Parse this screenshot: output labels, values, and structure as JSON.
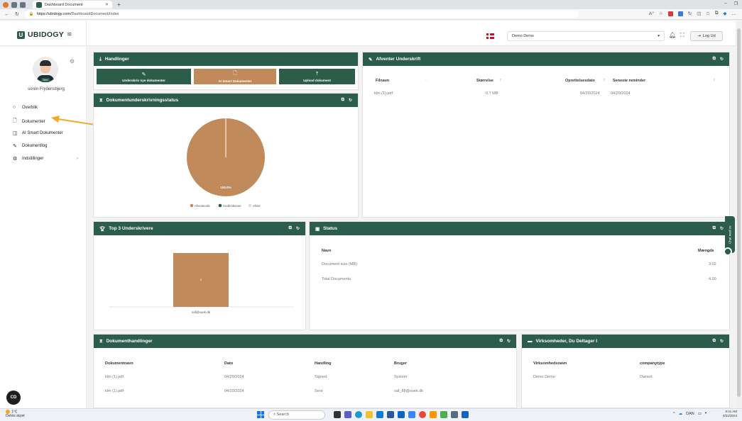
{
  "browser": {
    "tab_title": "Dashboard Document",
    "url_host": "https://ubidogy.com",
    "url_path": "/DashboardDocument/Index"
  },
  "header": {
    "brand": "UBIDOGY",
    "company_select": "Demo Demo",
    "logout_label": "Log Ud"
  },
  "sidebar": {
    "badge": "New",
    "username": "soren Frydensbjerg",
    "items": [
      {
        "label": "Overblik",
        "icon": "circle-icon"
      },
      {
        "label": "Dokumenter",
        "icon": "document-icon"
      },
      {
        "label": "AI Smart Dokumenter",
        "icon": "ai-document-icon"
      },
      {
        "label": "Dokumentlog",
        "icon": "pen-icon"
      },
      {
        "label": "Indstillinger",
        "icon": "gear-icon"
      }
    ]
  },
  "handlinger": {
    "title": "Handlinger",
    "buttons": [
      {
        "label": "Underskriv nye dokumenter",
        "color": "#2c5d4b"
      },
      {
        "label": "AI Smart Dokumenter",
        "color": "#c08a5a"
      },
      {
        "label": "Upload dokument",
        "color": "#2c5d4b"
      }
    ]
  },
  "status_chart": {
    "title": "Dokumentunderskrivningsstatus",
    "slice_label": "100.0%",
    "legend": [
      "Afventende",
      "Underskrevet",
      "Afvist"
    ]
  },
  "afventer": {
    "title": "Afventer Underskrift",
    "headers": [
      "Filnavn",
      "Størrelse",
      "Oprettelsesdato",
      "Seneste reminder"
    ],
    "rows": [
      {
        "filename": "klm (1).pdf",
        "size": "0.7 MB",
        "created": "04/20/2024",
        "reminder": "04/20/2024"
      }
    ]
  },
  "top3": {
    "title": "Top 3 Underskrivere",
    "bar_value": "1",
    "category": "saf@soek.dk"
  },
  "status_box": {
    "title": "Status",
    "headers": [
      "Navn",
      "Mængde"
    ],
    "rows": [
      {
        "name": "Document size (MB)",
        "value": "3.02"
      },
      {
        "name": "Total Documents",
        "value": "4.00"
      }
    ]
  },
  "handlinger_log": {
    "title": "Dokumenthandlinger",
    "headers": [
      "Dokumentnavn",
      "Dato",
      "Handling",
      "Bruger"
    ],
    "rows": [
      {
        "name": "klm (1).pdf",
        "date": "04/20/2024",
        "action": "Signed",
        "user": "System"
      },
      {
        "name": "klm (1).pdf",
        "date": "04/20/2024",
        "action": "Sent",
        "user": "saf_88@soek.dk"
      }
    ]
  },
  "virksomheder": {
    "title": "Virksomheder, Du Deltager I",
    "headers": [
      "Virksomhedsnavn",
      "companytype"
    ],
    "rows": [
      {
        "name": "Demo Demo",
        "type": "Owned"
      }
    ]
  },
  "chat": {
    "label": "Chat med os"
  },
  "cd_button": "CD",
  "taskbar": {
    "temp": "1°C",
    "weather": "Delvis skyet",
    "search": "Search",
    "lang": "DAN",
    "time": "8:41 AM",
    "date": "4/21/2024"
  },
  "chart_data": [
    {
      "type": "pie",
      "categories": [
        "Afventende",
        "Underskrevet",
        "Afvist"
      ],
      "values": [
        100,
        0,
        0
      ],
      "colors": [
        "#c08a5a",
        "#2c5d4b",
        "#dddddd"
      ],
      "legend": "bottom"
    },
    {
      "type": "bar",
      "categories": [
        "saf@soek.dk"
      ],
      "values": [
        1
      ],
      "colors": [
        "#c08a5a"
      ]
    }
  ]
}
